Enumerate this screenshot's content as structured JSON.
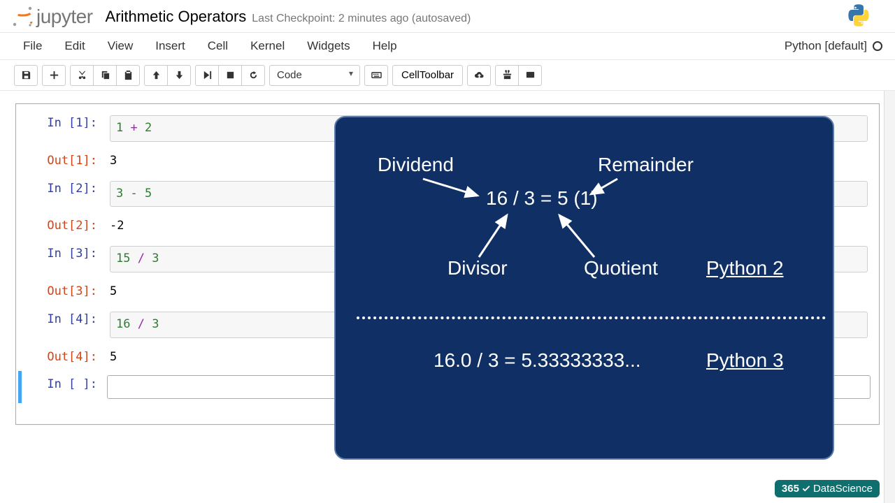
{
  "header": {
    "logo": "jupyter",
    "title": "Arithmetic Operators",
    "checkpoint": "Last Checkpoint: 2 minutes ago (autosaved)"
  },
  "menubar": {
    "items": [
      "File",
      "Edit",
      "View",
      "Insert",
      "Cell",
      "Kernel",
      "Widgets",
      "Help"
    ],
    "kernel": "Python [default]"
  },
  "toolbar": {
    "cell_type": "Code",
    "cell_toolbar": "CellToolbar"
  },
  "cells": [
    {
      "in_n": "1",
      "code_tokens": [
        [
          "1",
          "num"
        ],
        [
          " + ",
          "op"
        ],
        [
          "2",
          "num"
        ]
      ],
      "out_n": "1",
      "out": "3"
    },
    {
      "in_n": "2",
      "code_tokens": [
        [
          "3",
          "num"
        ],
        [
          " - ",
          "op"
        ],
        [
          "5",
          "num"
        ]
      ],
      "out_n": "2",
      "out": "-2"
    },
    {
      "in_n": "3",
      "code_tokens": [
        [
          "15",
          "num"
        ],
        [
          " / ",
          "op"
        ],
        [
          "3",
          "num"
        ]
      ],
      "out_n": "3",
      "out": "5"
    },
    {
      "in_n": "4",
      "code_tokens": [
        [
          "16",
          "num"
        ],
        [
          " / ",
          "op"
        ],
        [
          "3",
          "num"
        ]
      ],
      "out_n": "4",
      "out": "5"
    }
  ],
  "active_cell": {
    "in_label": "In [ ]:"
  },
  "overlay": {
    "dividend": "Dividend",
    "remainder": "Remainder",
    "expr1": "16 / 3 = 5 (1)",
    "divisor": "Divisor",
    "quotient": "Quotient",
    "py2": "Python 2",
    "expr2": "16.0 / 3 = 5.33333333...",
    "py3": "Python 3"
  },
  "watermark": {
    "brand": "365",
    "tagline": "DataScience"
  }
}
